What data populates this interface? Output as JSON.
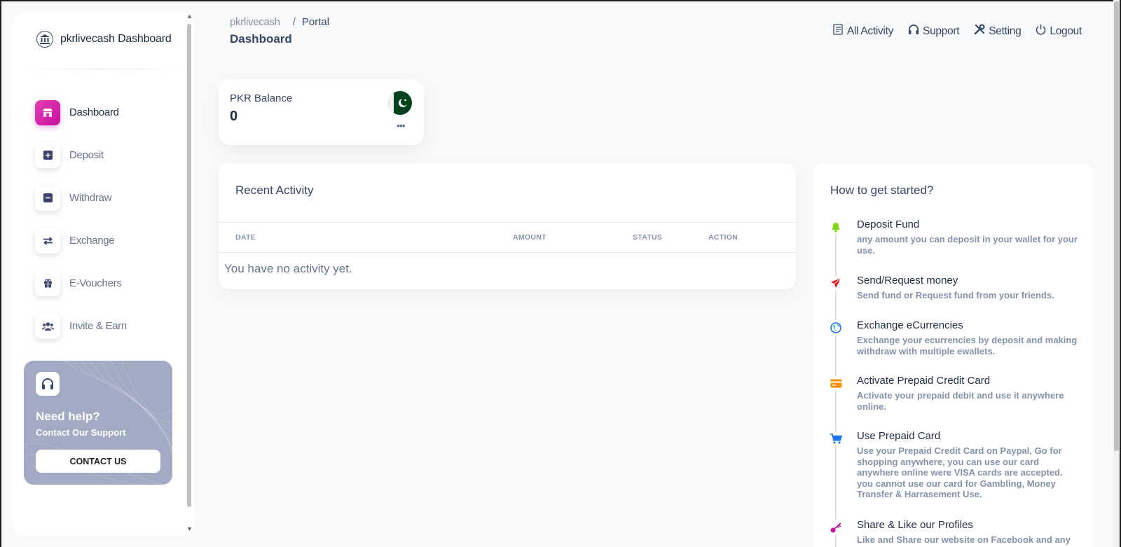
{
  "sidebar": {
    "brand": "pkrlivecash Dashboard",
    "items": [
      {
        "label": "Dashboard",
        "icon": "shop-icon",
        "active": true
      },
      {
        "label": "Deposit",
        "icon": "plus-square-icon"
      },
      {
        "label": "Withdraw",
        "icon": "minus-square-icon"
      },
      {
        "label": "Exchange",
        "icon": "exchange-icon"
      },
      {
        "label": "E-Vouchers",
        "icon": "gift-icon"
      },
      {
        "label": "Invite & Earn",
        "icon": "users-icon"
      }
    ],
    "help": {
      "title": "Need help?",
      "subtitle": "Contact Our Support",
      "button": "CONTACT US"
    }
  },
  "header": {
    "breadcrumb_parent": "pkrlivecash",
    "breadcrumb_sep": "/",
    "breadcrumb_current": "Portal",
    "title": "Dashboard",
    "actions": [
      {
        "label": "All Activity",
        "icon": "list-icon"
      },
      {
        "label": "Support",
        "icon": "headset-icon"
      },
      {
        "label": "Setting",
        "icon": "tools-icon"
      },
      {
        "label": "Logout",
        "icon": "power-icon"
      }
    ]
  },
  "balance": {
    "label": "PKR Balance",
    "value": "0",
    "menu": "•••"
  },
  "activity": {
    "title": "Recent Activity",
    "columns": [
      "DATE",
      "AMOUNT",
      "STATUS",
      "ACTION"
    ],
    "empty": "You have no activity yet."
  },
  "started": {
    "title": "How to get started?",
    "steps": [
      {
        "title": "Deposit Fund",
        "desc": "any amount you can deposit in your wallet for your use.",
        "icon": "bell-icon",
        "color": "#82d616"
      },
      {
        "title": "Send/Request money",
        "desc": "Send fund or Request fund from your friends.",
        "icon": "paper-plane-icon",
        "color": "#ea0606"
      },
      {
        "title": "Exchange eCurrencies",
        "desc": "Exchange your ecurrencies by deposit and making withdraw with multiple ewallets.",
        "icon": "globe-icon",
        "color": "#17c1e8"
      },
      {
        "title": "Activate Prepaid Credit Card",
        "desc": "Activate your prepaid debit and use it anywhere online.",
        "icon": "credit-card-icon",
        "color": "#fb8c00"
      },
      {
        "title": "Use Prepaid Card",
        "desc": "Use your Prepaid Credit Card on Paypal, Go for shopping anywhere, you can use our card anywhere online were VISA cards are accepted. you cannot use our card for Gambling, Money Transfer & Harrasement Use.",
        "icon": "cart-icon",
        "color": "#1a73e8"
      },
      {
        "title": "Share & Like our Profiles",
        "desc": "Like and Share our website on Facebook and any",
        "icon": "key-icon",
        "color": "#cb0c9f"
      }
    ]
  },
  "colors": {
    "accent": "#cb0c9f",
    "text": "#344767",
    "muted": "#8392ab",
    "background": "#f8f9fa"
  }
}
